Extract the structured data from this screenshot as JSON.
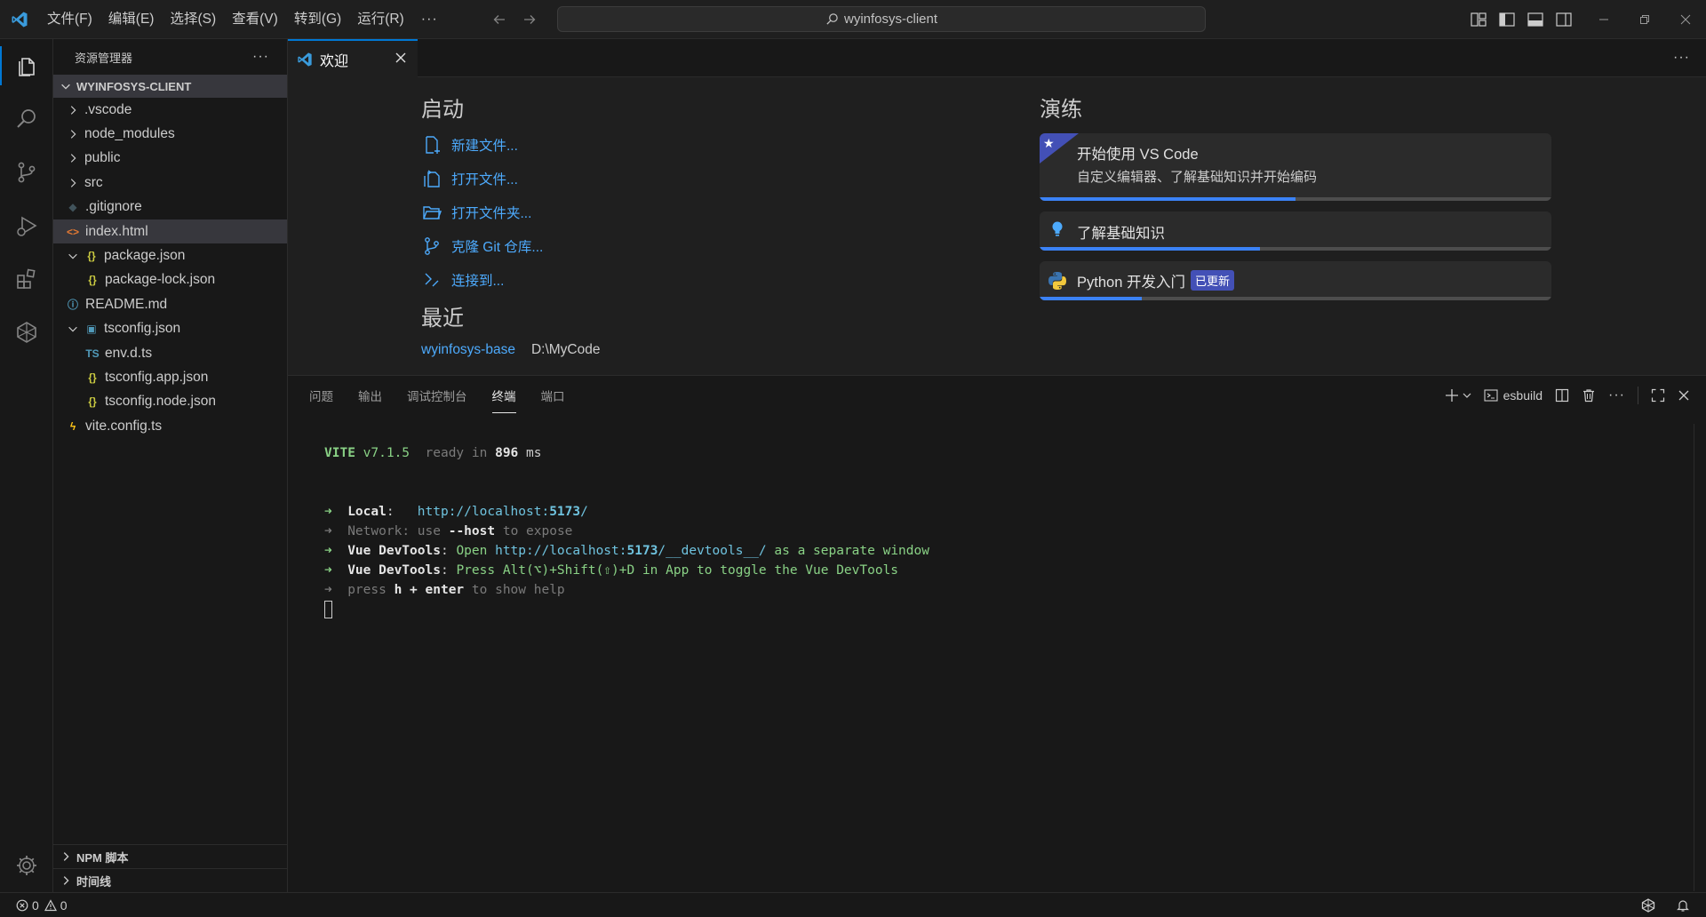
{
  "titlebar": {
    "menu": [
      "文件(F)",
      "编辑(E)",
      "选择(S)",
      "查看(V)",
      "转到(G)",
      "运行(R)"
    ],
    "more": "···",
    "search_text": "wyinfosys-client"
  },
  "activity": {
    "icons": [
      "explorer-icon",
      "search-icon",
      "source-control-icon",
      "run-debug-icon",
      "extensions-icon",
      "remote-icon"
    ],
    "bottom_icon": "settings-gear-icon"
  },
  "sidebar": {
    "title": "资源管理器",
    "more": "···",
    "workspace": "WYINFOSYS-CLIENT",
    "tree": [
      {
        "label": ".vscode",
        "kind": "folder",
        "indent": 0,
        "expanded": false
      },
      {
        "label": "node_modules",
        "kind": "folder",
        "indent": 0,
        "expanded": false
      },
      {
        "label": "public",
        "kind": "folder",
        "indent": 0,
        "expanded": false
      },
      {
        "label": "src",
        "kind": "folder",
        "indent": 0,
        "expanded": false
      },
      {
        "label": ".gitignore",
        "kind": "git",
        "indent": 0
      },
      {
        "label": "index.html",
        "kind": "html",
        "indent": 0,
        "selected": true
      },
      {
        "label": "package.json",
        "kind": "json",
        "indent": 0,
        "expanded": true,
        "has_twisty": true
      },
      {
        "label": "package-lock.json",
        "kind": "json",
        "indent": 1
      },
      {
        "label": "README.md",
        "kind": "info",
        "indent": 0
      },
      {
        "label": "tsconfig.json",
        "kind": "tsconfig",
        "indent": 0,
        "expanded": true,
        "has_twisty": true
      },
      {
        "label": "env.d.ts",
        "kind": "ts",
        "indent": 1
      },
      {
        "label": "tsconfig.app.json",
        "kind": "json",
        "indent": 1
      },
      {
        "label": "tsconfig.node.json",
        "kind": "json",
        "indent": 1
      },
      {
        "label": "vite.config.ts",
        "kind": "vite",
        "indent": 0
      }
    ],
    "bottom_sections": [
      "NPM 脚本",
      "时间线"
    ]
  },
  "editor": {
    "tab_label": "欢迎",
    "more": "···"
  },
  "welcome": {
    "start_title": "启动",
    "start_items": [
      {
        "label": "新建文件...",
        "icon": "new-file-icon"
      },
      {
        "label": "打开文件...",
        "icon": "open-file-icon"
      },
      {
        "label": "打开文件夹...",
        "icon": "open-folder-icon"
      },
      {
        "label": "克隆 Git 仓库...",
        "icon": "git-clone-icon"
      },
      {
        "label": "连接到...",
        "icon": "remote-connect-icon"
      }
    ],
    "recent_title": "最近",
    "recent": [
      {
        "name": "wyinfosys-base",
        "path": "D:\\MyCode"
      }
    ],
    "walk_title": "演练",
    "walkthroughs": [
      {
        "title": "开始使用 VS Code",
        "desc": "自定义编辑器、了解基础知识并开始编码",
        "progress": 0.5,
        "icon": "star-icon"
      },
      {
        "title": "了解基础知识",
        "progress": 0.43,
        "icon": "lightbulb-icon"
      },
      {
        "title": "Python 开发入门",
        "badge": "已更新",
        "progress": 0.2,
        "icon": "python-icon"
      }
    ]
  },
  "panel": {
    "tabs": [
      "问题",
      "输出",
      "调试控制台",
      "终端",
      "端口"
    ],
    "active_tab": "终端",
    "terminal_name": "esbuild",
    "lines": {
      "vite_name": "VITE",
      "vite_version": "v7.1.5",
      "ready": "ready in",
      "ready_ms": "896",
      "ms": "ms",
      "arrow": "➜",
      "local_label": "Local",
      "local_url_a": "http://localhost:",
      "local_port": "5173",
      "local_url_b": "/",
      "network_label": "Network",
      "network_use": "use",
      "network_flag": "--host",
      "network_rest": "to expose",
      "devtools_label": "Vue DevTools",
      "devtools_open": "Open",
      "devtools_url_a": "http://localhost:",
      "devtools_port": "5173",
      "devtools_url_b": "/__devtools__/",
      "devtools_rest": "as a separate window",
      "devtools2_text": "Press Alt(⌥)+Shift(⇧)+D in App to toggle the Vue DevTools",
      "press": "press",
      "press_key": "h + enter",
      "press_rest": "to show help"
    }
  },
  "status": {
    "errors": "0",
    "warnings": "0"
  }
}
